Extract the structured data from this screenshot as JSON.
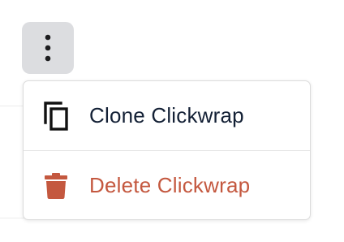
{
  "menu": {
    "trigger_icon": "vertical-ellipsis-icon",
    "items": [
      {
        "label": "Clone Clickwrap",
        "icon": "copy-icon",
        "color": "#132035"
      },
      {
        "label": "Delete Clickwrap",
        "icon": "trash-icon",
        "color": "#c4583f"
      }
    ]
  },
  "colors": {
    "trigger_background": "#dcdde0",
    "danger": "#c4583f",
    "text": "#132035"
  }
}
